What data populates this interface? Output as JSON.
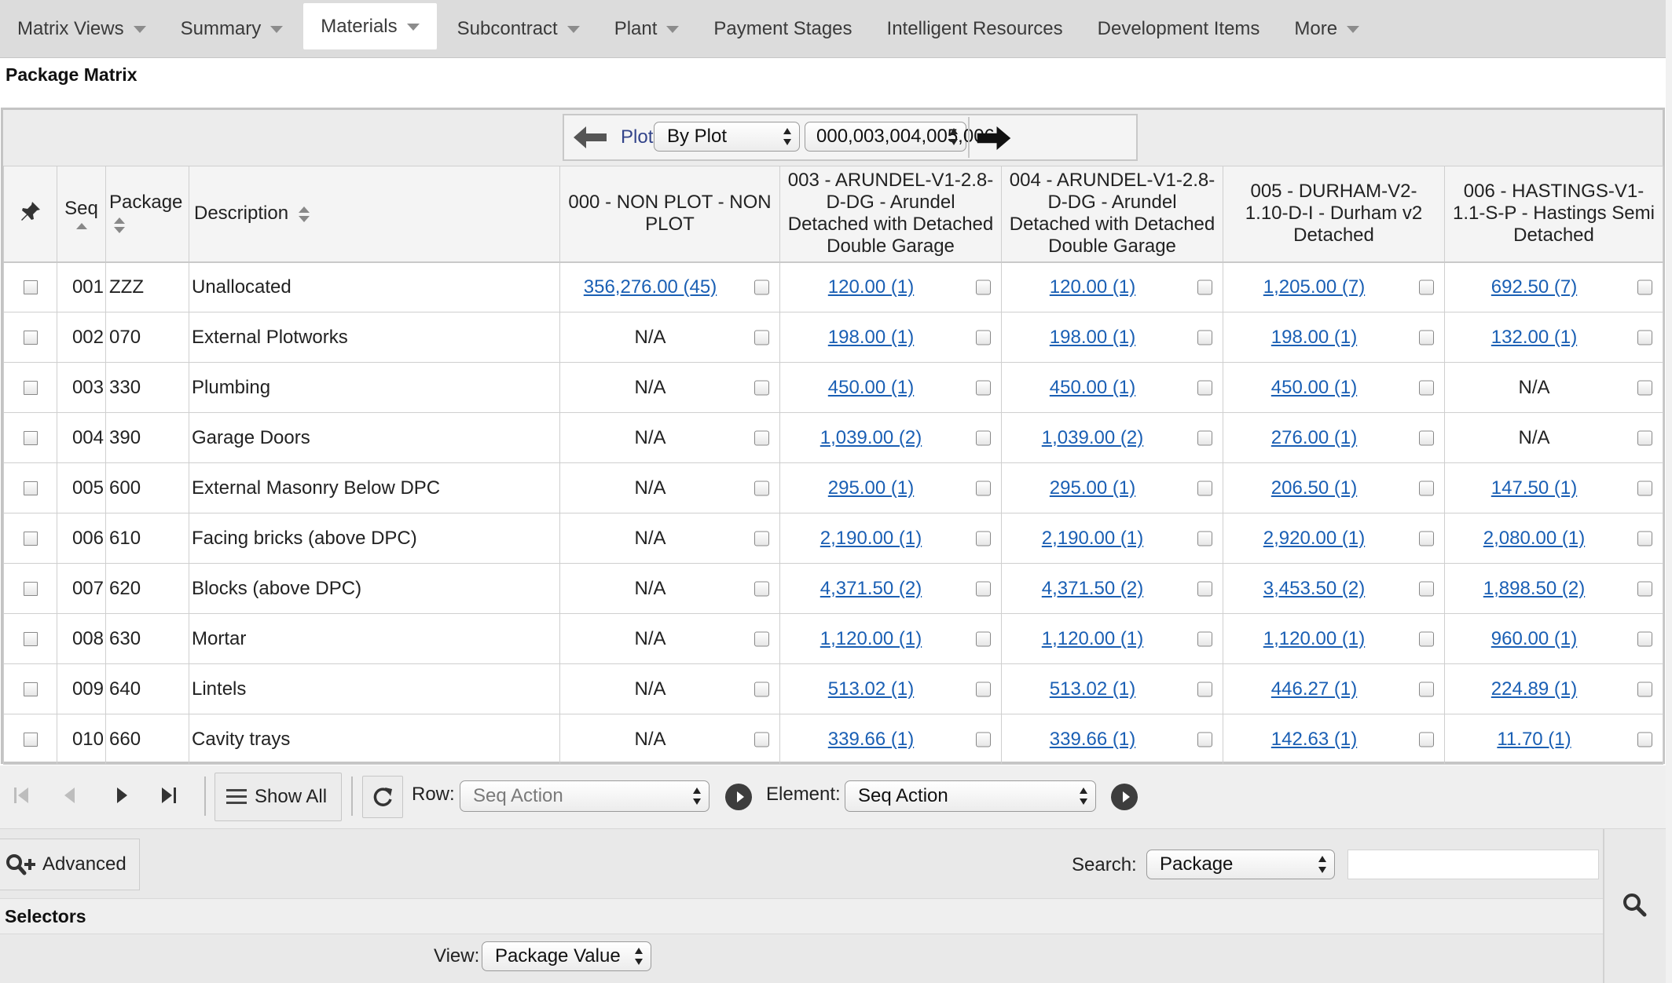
{
  "nav": {
    "tabs": [
      {
        "label": "Matrix Views",
        "dropdown": true,
        "active": false
      },
      {
        "label": "Summary",
        "dropdown": true,
        "active": false
      },
      {
        "label": "Materials",
        "dropdown": true,
        "active": true
      },
      {
        "label": "Subcontract",
        "dropdown": true,
        "active": false
      },
      {
        "label": "Plant",
        "dropdown": true,
        "active": false
      },
      {
        "label": "Payment Stages",
        "dropdown": false,
        "active": false
      },
      {
        "label": "Intelligent Resources",
        "dropdown": false,
        "active": false
      },
      {
        "label": "Development Items",
        "dropdown": false,
        "active": false
      },
      {
        "label": "More",
        "dropdown": true,
        "active": false
      }
    ]
  },
  "page_title": "Package Matrix",
  "matrix": {
    "plot_label": "Plot",
    "plot_mode": "By Plot",
    "plot_range": "000,003,004,005,006",
    "headers": {
      "seq": "Seq",
      "package": "Package",
      "description": "Description"
    },
    "plots": [
      "000 - NON PLOT - NON PLOT",
      "003 - ARUNDEL-V1-2.8-D-DG - Arundel Detached with Detached Double Garage",
      "004 - ARUNDEL-V1-2.8-D-DG - Arundel Detached with Detached Double Garage",
      "005 - DURHAM-V2-1.10-D-I - Durham v2 Detached",
      "006 - HASTINGS-V1-1.1-S-P - Hastings Semi Detached"
    ],
    "rows": [
      {
        "seq": "001",
        "package": "ZZZ",
        "description": "Unallocated",
        "values": [
          "356,276.00 (45)",
          "120.00 (1)",
          "120.00 (1)",
          "1,205.00 (7)",
          "692.50 (7)"
        ]
      },
      {
        "seq": "002",
        "package": "070",
        "description": "External Plotworks",
        "values": [
          "N/A",
          "198.00 (1)",
          "198.00 (1)",
          "198.00 (1)",
          "132.00 (1)"
        ]
      },
      {
        "seq": "003",
        "package": "330",
        "description": "Plumbing",
        "values": [
          "N/A",
          "450.00 (1)",
          "450.00 (1)",
          "450.00 (1)",
          "N/A"
        ]
      },
      {
        "seq": "004",
        "package": "390",
        "description": "Garage Doors",
        "values": [
          "N/A",
          "1,039.00 (2)",
          "1,039.00 (2)",
          "276.00 (1)",
          "N/A"
        ]
      },
      {
        "seq": "005",
        "package": "600",
        "description": "External Masonry Below DPC",
        "values": [
          "N/A",
          "295.00 (1)",
          "295.00 (1)",
          "206.50 (1)",
          "147.50 (1)"
        ]
      },
      {
        "seq": "006",
        "package": "610",
        "description": "Facing bricks (above DPC)",
        "values": [
          "N/A",
          "2,190.00 (1)",
          "2,190.00 (1)",
          "2,920.00 (1)",
          "2,080.00 (1)"
        ]
      },
      {
        "seq": "007",
        "package": "620",
        "description": "Blocks (above DPC)",
        "values": [
          "N/A",
          "4,371.50 (2)",
          "4,371.50 (2)",
          "3,453.50 (2)",
          "1,898.50 (2)"
        ]
      },
      {
        "seq": "008",
        "package": "630",
        "description": "Mortar",
        "values": [
          "N/A",
          "1,120.00 (1)",
          "1,120.00 (1)",
          "1,120.00 (1)",
          "960.00 (1)"
        ]
      },
      {
        "seq": "009",
        "package": "640",
        "description": "Lintels",
        "values": [
          "N/A",
          "513.02 (1)",
          "513.02 (1)",
          "446.27 (1)",
          "224.89 (1)"
        ]
      },
      {
        "seq": "010",
        "package": "660",
        "description": "Cavity trays",
        "values": [
          "N/A",
          "339.66 (1)",
          "339.66 (1)",
          "142.63 (1)",
          "11.70 (1)"
        ]
      }
    ]
  },
  "pager": {
    "show_all": "Show All",
    "row_label": "Row:",
    "row_action": "Seq Action",
    "element_label": "Element:",
    "element_action": "Seq Action"
  },
  "lower": {
    "advanced": "Advanced",
    "search_label": "Search:",
    "search_field": "Package",
    "search_value": "",
    "selectors_title": "Selectors",
    "view_label": "View:",
    "view_value": "Package Value"
  },
  "colors": {
    "link": "#1a5fb4",
    "nav_bg": "#dcdcdc",
    "plot_label": "#33448a"
  },
  "icons": [
    "pin-icon",
    "arrow-left-icon",
    "arrow-right-icon",
    "first-page-icon",
    "prev-page-icon",
    "next-page-icon",
    "last-page-icon",
    "list-icon",
    "refresh-icon",
    "go-icon",
    "search-plus-icon",
    "search-icon"
  ]
}
